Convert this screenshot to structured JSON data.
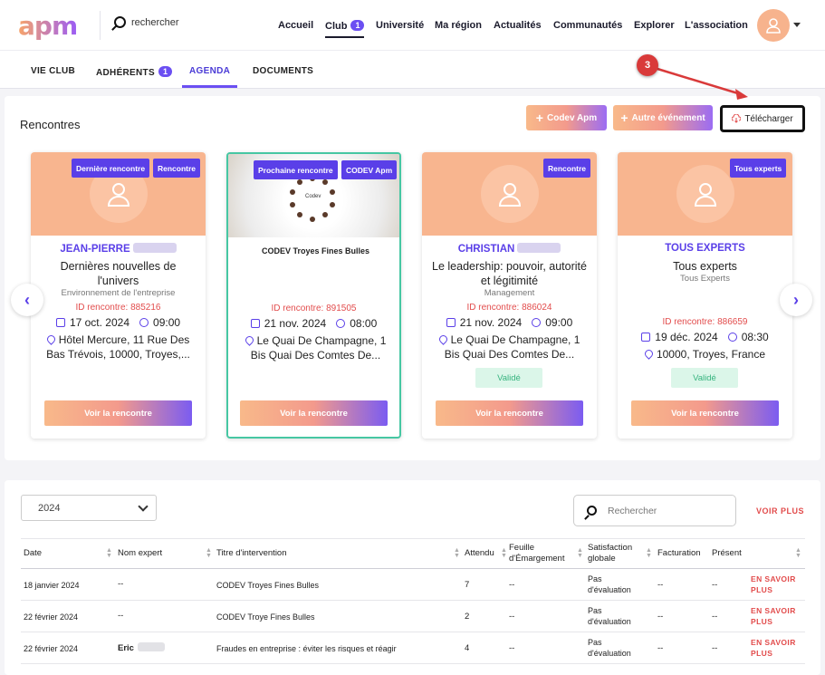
{
  "header": {
    "logo": "apm",
    "search_placeholder": "rechercher",
    "nav": [
      {
        "label": "Accueil"
      },
      {
        "label": "Club",
        "badge": "1"
      },
      {
        "label": "Université"
      },
      {
        "label": "Ma région"
      },
      {
        "label": "Actualités"
      },
      {
        "label": "Communautés"
      },
      {
        "label": "Explorer"
      },
      {
        "label": "L'association"
      }
    ]
  },
  "subnav": [
    {
      "label": "VIE CLUB"
    },
    {
      "label": "ADHÉRENTS",
      "badge": "1"
    },
    {
      "label": "AGENDA"
    },
    {
      "label": "DOCUMENTS"
    }
  ],
  "rencontres": {
    "title": "Rencontres",
    "btn_codev": "Codev Apm",
    "btn_autre": "Autre événement",
    "btn_download": "Télécharger",
    "annotation": "3",
    "cards": [
      {
        "tags": [
          "Dernière rencontre",
          "Rencontre"
        ],
        "name": "JEAN-PIERRE",
        "title": "Dernières nouvelles de l'univers",
        "domain": "Environnement de l'entreprise",
        "id": "ID rencontre: 885216",
        "date": "17 oct. 2024",
        "time": "09:00",
        "location": "Hôtel Mercure, 11 Rue Des Bas Trévois, 10000, Troyes,...",
        "cta": "Voir la rencontre"
      },
      {
        "tags": [
          "Prochaine rencontre",
          "CODEV Apm"
        ],
        "name": "",
        "title": "CODEV Troyes Fines Bulles",
        "image_label": "Codev",
        "domain": "",
        "id": "ID rencontre: 891505",
        "date": "21 nov. 2024",
        "time": "08:00",
        "location": "Le Quai De Champagne, 1 Bis Quai Des Comtes De...",
        "cta": "Voir la rencontre"
      },
      {
        "tags": [
          "Rencontre"
        ],
        "name": "CHRISTIAN",
        "title": "Le leadership: pouvoir, autorité et légitimité",
        "domain": "Management",
        "id": "ID rencontre: 886024",
        "date": "21 nov. 2024",
        "time": "09:00",
        "location": "Le Quai De Champagne, 1 Bis Quai Des Comtes De...",
        "status": "Validé",
        "cta": "Voir la rencontre"
      },
      {
        "tags": [
          "Tous experts"
        ],
        "name": "TOUS EXPERTS",
        "title": "Tous experts",
        "domain": "Tous Experts",
        "id": "ID rencontre: 886659",
        "date": "19 déc. 2024",
        "time": "08:30",
        "location": "10000, Troyes, France",
        "status": "Validé",
        "cta": "Voir la rencontre"
      }
    ]
  },
  "table": {
    "year": "2024",
    "search_placeholder": "Rechercher",
    "voir_plus": "VOIR PLUS",
    "headers": [
      "Date",
      "Nom expert",
      "Titre d'intervention",
      "Attendu",
      "Feuille d'Émargement",
      "Satisfaction globale",
      "Facturation",
      "Présent"
    ],
    "rows": [
      {
        "date": "18 janvier 2024",
        "expert": "--",
        "titre": "CODEV Troyes Fines Bulles",
        "attendu": "7",
        "feuille": "--",
        "satisfaction": "Pas d'évaluation",
        "facturation": "--",
        "present": "--",
        "action": "EN SAVOIR PLUS"
      },
      {
        "date": "22 février 2024",
        "expert": "--",
        "titre": "CODEV Troye Fines Bulles",
        "attendu": "2",
        "feuille": "--",
        "satisfaction": "Pas d'évaluation",
        "facturation": "--",
        "present": "--",
        "action": "EN SAVOIR PLUS"
      },
      {
        "date": "22 février 2024",
        "expert": "Eric",
        "titre": "Fraudes en entreprise : éviter les risques et réagir",
        "attendu": "4",
        "feuille": "--",
        "satisfaction": "Pas d'évaluation",
        "facturation": "--",
        "present": "--",
        "action": "EN SAVOIR PLUS"
      }
    ]
  }
}
